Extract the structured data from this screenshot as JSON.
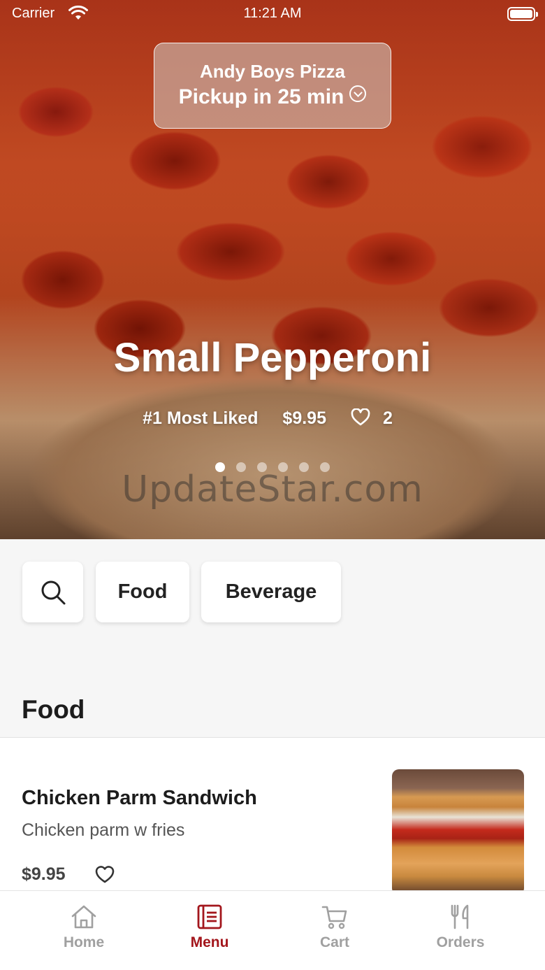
{
  "status_bar": {
    "carrier": "Carrier",
    "time": "11:21 AM",
    "wifi_icon": "wifi-icon",
    "battery_icon": "battery-icon"
  },
  "pickup": {
    "store": "Andy Boys Pizza",
    "eta": "Pickup in 25 min",
    "icon": "chevron-down-circle-icon"
  },
  "hero": {
    "title": "Small Pepperoni",
    "rank": "#1 Most Liked",
    "price": "$9.95",
    "likes": "2",
    "slide_count": 6,
    "active_slide": 1,
    "watermark": "UpdateStar.com"
  },
  "categories": {
    "search_icon": "search-icon",
    "food": "Food",
    "beverage": "Beverage"
  },
  "section": {
    "title": "Food"
  },
  "items": [
    {
      "name": "Chicken Parm Sandwich",
      "description": "Chicken parm w fries",
      "price": "$9.95",
      "like_icon": "heart-icon"
    }
  ],
  "tabs": [
    {
      "label": "Home",
      "icon": "home-icon",
      "active": false
    },
    {
      "label": "Menu",
      "icon": "menu-icon",
      "active": true
    },
    {
      "label": "Cart",
      "icon": "cart-icon",
      "active": false
    },
    {
      "label": "Orders",
      "icon": "fork-knife-icon",
      "active": false
    }
  ],
  "colors": {
    "accent": "#a3161c",
    "inactive": "#a0a0a0",
    "background": "#f6f6f6"
  }
}
